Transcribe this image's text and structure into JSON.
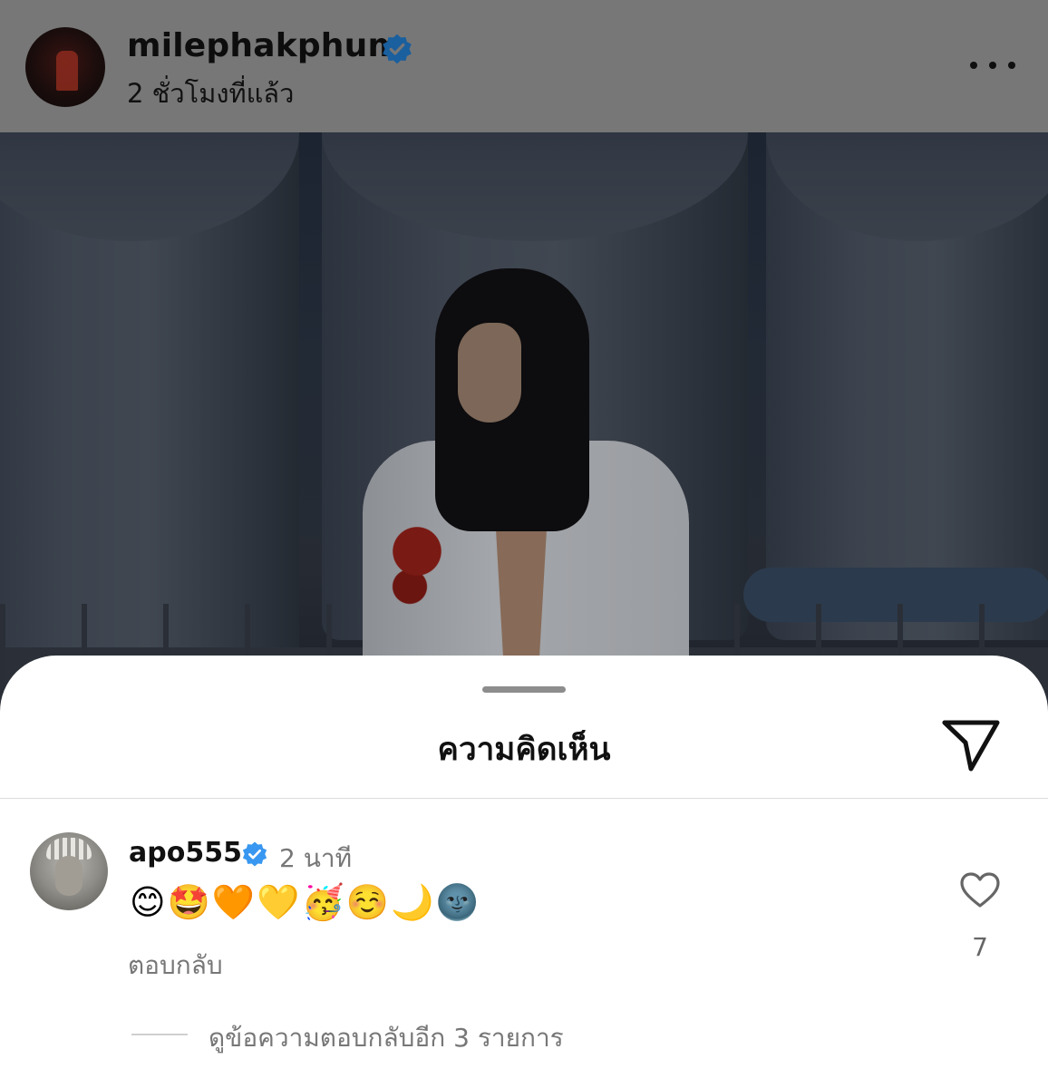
{
  "post": {
    "username": "milephakphum",
    "time": "2 ชั่วโมงที่แล้ว",
    "verified": true,
    "more_icon": "more-horizontal-icon"
  },
  "photo": {
    "description": "dimmed post photo"
  },
  "comments_sheet": {
    "title": "ความคิดเห็น",
    "share_icon": "send-icon",
    "comment": {
      "username": "apo555",
      "verified": true,
      "time": "2 นาที",
      "text": "😊🤩🧡💛🥳☺️🌙🌚",
      "reply_label": "ตอบกลับ",
      "like_icon": "heart-outline-icon",
      "like_count": "7"
    },
    "view_replies_label": "ดูข้อความตอบกลับอีก 3 รายการ"
  },
  "colors": {
    "verified_blue": "#3897f0",
    "dim_overlay": "#777777",
    "secondary_text": "#777777"
  }
}
